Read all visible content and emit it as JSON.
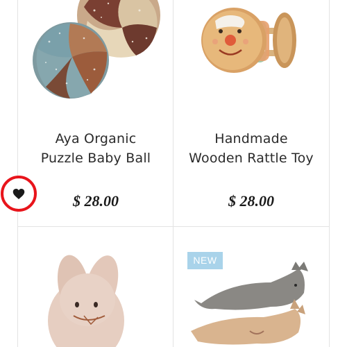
{
  "products": [
    {
      "title_line1": "Aya Organic",
      "title_line2": "Puzzle Baby Ball",
      "price": "$ 28.00",
      "image": "puzzle-ball-image"
    },
    {
      "title_line1": "Handmade",
      "title_line2": "Wooden Rattle Toy",
      "price": "$ 28.00",
      "image": "wooden-rattle-image"
    },
    {
      "image": "bunny-plush-image"
    },
    {
      "badge": "NEW",
      "image": "cat-plush-image"
    }
  ],
  "wishlist": {
    "icon": "heart-icon"
  },
  "colors": {
    "divider": "#e3e3e3",
    "badge": "#a9d3ea",
    "wishlist_ring": "#e8141b"
  }
}
